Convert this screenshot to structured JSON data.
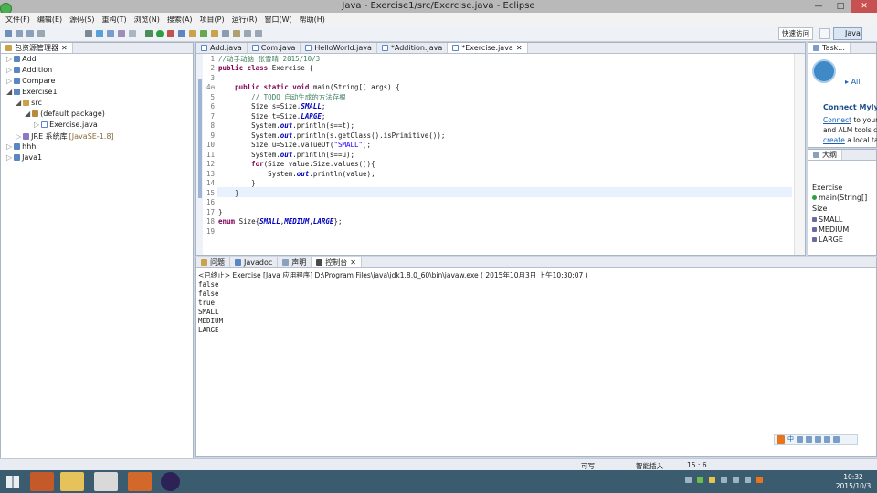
{
  "window": {
    "title": "Java - Exercise1/src/Exercise.java - Eclipse",
    "minimize": "—",
    "maximize": "□",
    "close": "✕"
  },
  "menu": [
    "文件(F)",
    "编辑(E)",
    "源码(S)",
    "重构(T)",
    "浏览(N)",
    "搜索(A)",
    "项目(P)",
    "运行(R)",
    "窗口(W)",
    "帮助(H)"
  ],
  "toolbar": {
    "quick_access": "快速访问",
    "perspective": "Java"
  },
  "package_explorer": {
    "title": "包资源管理器",
    "items": [
      {
        "label": "Add",
        "level": 0
      },
      {
        "label": "Addition",
        "level": 0
      },
      {
        "label": "Compare",
        "level": 0
      },
      {
        "label": "Exercise1",
        "level": 0
      },
      {
        "label": "src",
        "level": 1
      },
      {
        "label": "(default package)",
        "level": 2
      },
      {
        "label": "Exercise.java",
        "level": 3
      },
      {
        "label": "JRE 系统库",
        "suffix": "[JavaSE-1.8]",
        "level": 1
      },
      {
        "label": "hhh",
        "level": 0
      },
      {
        "label": "Java1",
        "level": 0
      }
    ]
  },
  "editor_tabs": [
    "Add.java",
    "Com.java",
    "HelloWorld.java",
    "*Addition.java",
    "*Exercise.java"
  ],
  "code_lines": [
    {
      "n": "1",
      "html": "<span class=\"cm\">//动手动脑 张雪晴 2015/10/3</span>"
    },
    {
      "n": "2",
      "html": "<span class=\"kw\">public class</span> Exercise {"
    },
    {
      "n": "3",
      "html": ""
    },
    {
      "n": "4⊖",
      "html": "    <span class=\"kw\">public static void</span> main(String[] args) {"
    },
    {
      "n": "5",
      "html": "        <span class=\"cm\">// TODO 自动生成的方法存根</span>"
    },
    {
      "n": "6",
      "html": "        Size s=Size.<span class=\"fld\">SMALL</span>;"
    },
    {
      "n": "7",
      "html": "        Size t=Size.<span class=\"fld\">LARGE</span>;"
    },
    {
      "n": "8",
      "html": "        System.<span class=\"fld\">out</span>.println(s==t);"
    },
    {
      "n": "9",
      "html": "        System.<span class=\"fld\">out</span>.println(s.getClass().isPrimitive());"
    },
    {
      "n": "10",
      "html": "        Size u=Size.valueOf(<span class=\"str\">\"SMALL\"</span>);"
    },
    {
      "n": "11",
      "html": "        System.<span class=\"fld\">out</span>.println(s==u);"
    },
    {
      "n": "12",
      "html": "        <span class=\"kw\">for</span>(Size value:Size.values()){"
    },
    {
      "n": "13",
      "html": "            System.<span class=\"fld\">out</span>.println(value);"
    },
    {
      "n": "14",
      "html": "        }"
    },
    {
      "n": "15",
      "html": "    }"
    },
    {
      "n": "16",
      "html": ""
    },
    {
      "n": "17",
      "html": "}"
    },
    {
      "n": "18",
      "html": "<span class=\"kw\">enum</span> Size{<span class=\"fld\">SMALL</span>,<span class=\"fld\">MEDIUM</span>,<span class=\"fld\">LARGE</span>};"
    },
    {
      "n": "19",
      "html": ""
    }
  ],
  "right_panel": {
    "task_tab": "Task...",
    "find_all": "All",
    "connect_title": "Connect Myly",
    "connect_line1_link": "Connect",
    "connect_line1_rest": " to your",
    "connect_line2": "and ALM tools c",
    "connect_line3_link": "create",
    "connect_line3_rest": " a local tas"
  },
  "outline": {
    "title": "大纲",
    "items": [
      "Exercise",
      "main(String[]",
      "Size",
      "SMALL",
      "MEDIUM",
      "LARGE"
    ]
  },
  "bottom_tabs": [
    "问题",
    "Javadoc",
    "声明",
    "控制台"
  ],
  "console": {
    "header": "<已终止> Exercise [Java 应用程序] D:\\Program Files\\java\\jdk1.8.0_60\\bin\\javaw.exe ( 2015年10月3日 上午10:30:07 )",
    "output": [
      "false",
      "false",
      "true",
      "SMALL",
      "MEDIUM",
      "LARGE"
    ]
  },
  "statusbar": {
    "writable": "可写",
    "insert_mode": "智能插入",
    "position": "15 : 6"
  },
  "ime": {
    "lang": "中"
  },
  "tray": {
    "time": "10:32",
    "date": "2015/10/3"
  },
  "colors": {
    "accent": "#4a7ebb",
    "taskbar": "#3b5b6e"
  }
}
